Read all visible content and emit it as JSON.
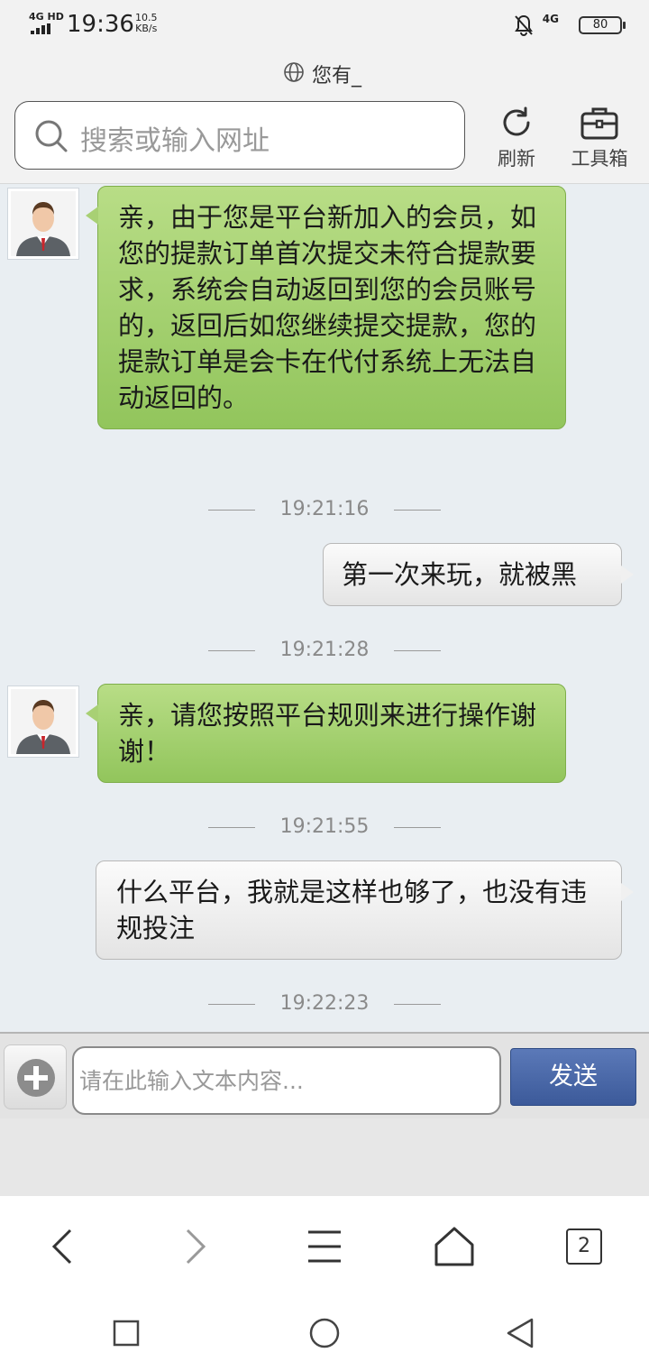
{
  "status_bar": {
    "network": "4G HD",
    "time": "19:36",
    "speed_value": "10.5",
    "speed_unit": "KB/s",
    "network_right": "4G",
    "battery": "80"
  },
  "browser": {
    "page_title": "您有_",
    "search_placeholder": "搜索或输入网址",
    "refresh_label": "刷新",
    "toolbox_label": "工具箱",
    "tab_count": "2"
  },
  "chat": {
    "messages": [
      {
        "side": "in",
        "text": "亲，由于您是平台新加入的会员，如您的提款订单首次提交未符合提款要求，系统会自动返回到您的会员账号的，返回后如您继续提交提款，您的提款订单是会卡在代付系统上无法自动返回的。"
      },
      {
        "timestamp": "19:21:16"
      },
      {
        "side": "out",
        "text": "第一次来玩，就被黑"
      },
      {
        "timestamp": "19:21:28"
      },
      {
        "side": "in",
        "text": "亲，请您按照平台规则来进行操作谢谢！"
      },
      {
        "timestamp": "19:21:55"
      },
      {
        "side": "out",
        "text": "什么平台，我就是这样也够了，也没有违规投注"
      },
      {
        "timestamp": "19:22:23"
      }
    ]
  },
  "composer": {
    "placeholder": "请在此输入文本内容...",
    "send_label": "发送"
  },
  "colors": {
    "incoming_bubble": "#a8d074",
    "outgoing_bubble": "#efefef",
    "send_button": "#4a68a8",
    "chat_background": "#e9eef2"
  }
}
